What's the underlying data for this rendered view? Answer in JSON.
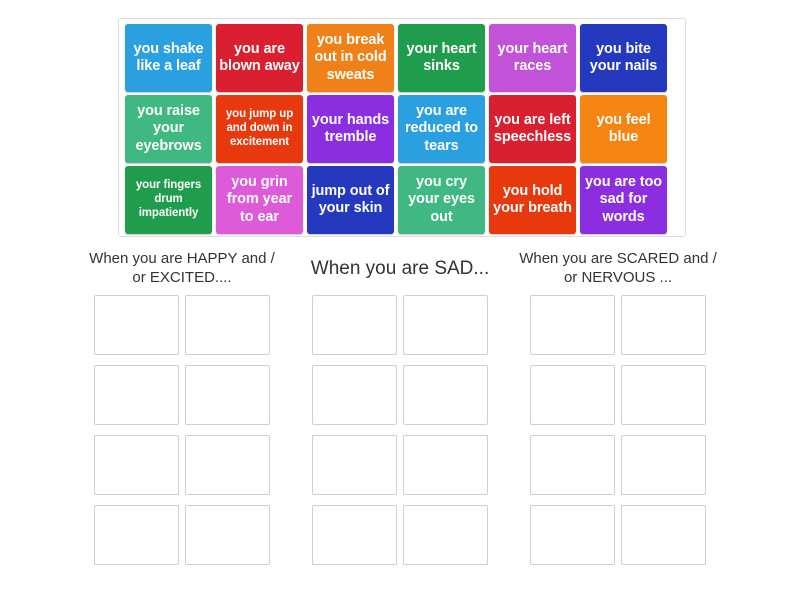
{
  "word_bank": {
    "name": "word-bank",
    "tiles": [
      {
        "text": "you shake like a leaf",
        "color": "#2ba0e0",
        "size": "normal"
      },
      {
        "text": "you are blown away",
        "color": "#d91f30",
        "size": "normal"
      },
      {
        "text": "you break out in cold sweats",
        "color": "#ef8118",
        "size": "normal"
      },
      {
        "text": "your heart sinks",
        "color": "#1f9d4d",
        "size": "normal"
      },
      {
        "text": "your heart races",
        "color": "#c253d8",
        "size": "normal"
      },
      {
        "text": "you bite your nails",
        "color": "#2439bd",
        "size": "normal"
      },
      {
        "text": "you raise your eyebrows",
        "color": "#3fb882",
        "size": "normal"
      },
      {
        "text": "you jump up and down in excitement",
        "color": "#e8380d",
        "size": "small"
      },
      {
        "text": "your hands tremble",
        "color": "#8a2ee0",
        "size": "normal"
      },
      {
        "text": "you are reduced to tears",
        "color": "#2ba0e0",
        "size": "normal"
      },
      {
        "text": "you are left speechless",
        "color": "#d91f30",
        "size": "normal"
      },
      {
        "text": "you feel blue",
        "color": "#f58410",
        "size": "normal"
      },
      {
        "text": "your fingers drum impatiently",
        "color": "#1f9d4d",
        "size": "small"
      },
      {
        "text": "you grin from year to ear",
        "color": "#dd5ad8",
        "size": "normal"
      },
      {
        "text": "jump out of your skin",
        "color": "#2439bd",
        "size": "normal"
      },
      {
        "text": "you cry your eyes out",
        "color": "#3fb882",
        "size": "normal"
      },
      {
        "text": "you hold your breath",
        "color": "#e8380d",
        "size": "normal"
      },
      {
        "text": "you are too sad for words",
        "color": "#8a2ee0",
        "size": "normal"
      }
    ]
  },
  "board": {
    "columns": [
      {
        "title": "When you are HAPPY and / or EXCITED....",
        "title_size": "normal",
        "slot_count": 8
      },
      {
        "title": "When you are SAD...",
        "title_size": "big",
        "slot_count": 8
      },
      {
        "title": "When you are SCARED and / or NERVOUS ...",
        "title_size": "normal",
        "slot_count": 8
      }
    ]
  }
}
